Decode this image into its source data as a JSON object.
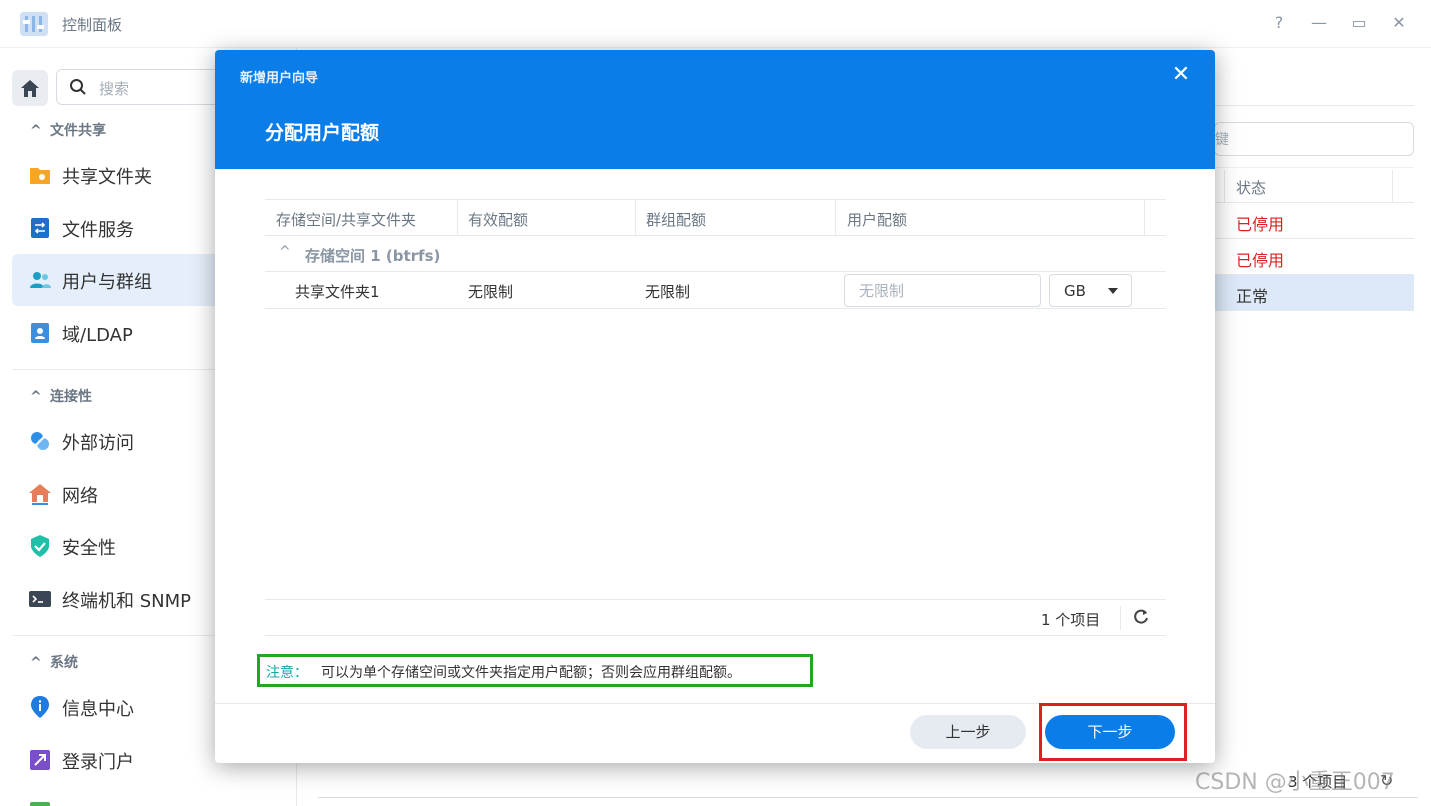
{
  "window": {
    "title": "控制面板",
    "controls": [
      "?",
      "—",
      "▭",
      "✕"
    ]
  },
  "sidebar": {
    "search_placeholder": "搜索",
    "sections": [
      {
        "label": "文件共享",
        "items": [
          "共享文件夹",
          "文件服务",
          "用户与群组",
          "域/LDAP"
        ]
      },
      {
        "label": "连接性",
        "items": [
          "外部访问",
          "网络",
          "安全性",
          "终端机和 SNMP"
        ]
      },
      {
        "label": "系统",
        "items": [
          "信息中心",
          "登录门户"
        ]
      }
    ],
    "active_item": "用户与群组"
  },
  "background": {
    "search_fragment": "键",
    "status_header": "状态",
    "rows": [
      {
        "status": "已停用",
        "color": "#e02020"
      },
      {
        "status": "已停用",
        "color": "#e02020"
      },
      {
        "status": "正常",
        "color": "#333333"
      }
    ],
    "footer_count": "3 个项目",
    "watermark": "CSDN @小重王007"
  },
  "modal": {
    "wizard_title": "新增用户向导",
    "step_title": "分配用户配额",
    "columns": [
      "存储空间/共享文件夹",
      "有效配额",
      "群组配额",
      "用户配额"
    ],
    "group": "存储空间 1 (btrfs)",
    "rows": [
      {
        "folder": "共享文件夹1",
        "effective": "无限制",
        "group_quota": "无限制",
        "user_quota_placeholder": "无限制",
        "unit": "GB"
      }
    ],
    "item_count": "1 个项目",
    "note_label": "注意：",
    "note_text": "可以为单个存储空间或文件夹指定用户配额；否则会应用群组配额。",
    "prev_label": "上一步",
    "next_label": "下一步"
  },
  "colors": {
    "accent": "#0a7de8",
    "note_border": "#22a722",
    "highlight_border": "#e02020"
  }
}
